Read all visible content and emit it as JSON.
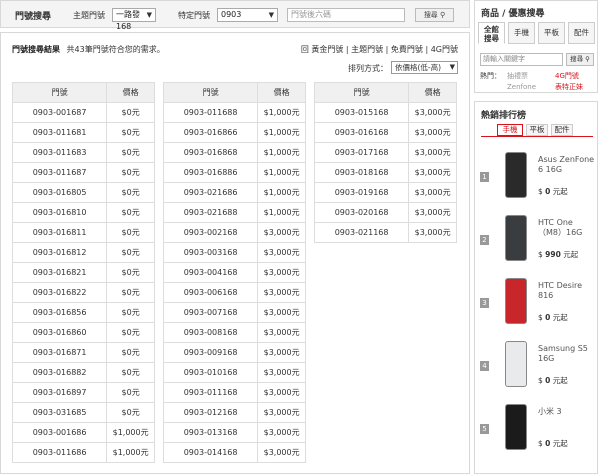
{
  "search": {
    "title": "門號搜尋",
    "theme_label": "主題門號",
    "theme_value": "一路發168",
    "prefix_label": "特定門號",
    "prefix_value": "0903",
    "suffix_placeholder": "門號後六碼",
    "button_label": "搜尋"
  },
  "results": {
    "title": "門號搜尋結果",
    "summary": "共43筆門號符合您的需求。",
    "filter_mark": "回",
    "filters": [
      "黃金門號",
      "主題門號",
      "免費門號",
      "4G門號"
    ],
    "sort_label": "排列方式：",
    "sort_value": "依價格(低-高)",
    "headers": {
      "number": "門號",
      "price": "價格"
    },
    "col1": [
      [
        "0903-001687",
        "$0元"
      ],
      [
        "0903-011681",
        "$0元"
      ],
      [
        "0903-011683",
        "$0元"
      ],
      [
        "0903-011687",
        "$0元"
      ],
      [
        "0903-016805",
        "$0元"
      ],
      [
        "0903-016810",
        "$0元"
      ],
      [
        "0903-016811",
        "$0元"
      ],
      [
        "0903-016812",
        "$0元"
      ],
      [
        "0903-016821",
        "$0元"
      ],
      [
        "0903-016822",
        "$0元"
      ],
      [
        "0903-016856",
        "$0元"
      ],
      [
        "0903-016860",
        "$0元"
      ],
      [
        "0903-016871",
        "$0元"
      ],
      [
        "0903-016882",
        "$0元"
      ],
      [
        "0903-016897",
        "$0元"
      ],
      [
        "0903-031685",
        "$0元"
      ],
      [
        "0903-001686",
        "$1,000元"
      ],
      [
        "0903-011686",
        "$1,000元"
      ]
    ],
    "col2": [
      [
        "0903-011688",
        "$1,000元"
      ],
      [
        "0903-016866",
        "$1,000元"
      ],
      [
        "0903-016868",
        "$1,000元"
      ],
      [
        "0903-016886",
        "$1,000元"
      ],
      [
        "0903-021686",
        "$1,000元"
      ],
      [
        "0903-021688",
        "$1,000元"
      ],
      [
        "0903-002168",
        "$3,000元"
      ],
      [
        "0903-003168",
        "$3,000元"
      ],
      [
        "0903-004168",
        "$3,000元"
      ],
      [
        "0903-006168",
        "$3,000元"
      ],
      [
        "0903-007168",
        "$3,000元"
      ],
      [
        "0903-008168",
        "$3,000元"
      ],
      [
        "0903-009168",
        "$3,000元"
      ],
      [
        "0903-010168",
        "$3,000元"
      ],
      [
        "0903-011168",
        "$3,000元"
      ],
      [
        "0903-012168",
        "$3,000元"
      ],
      [
        "0903-013168",
        "$3,000元"
      ],
      [
        "0903-014168",
        "$3,000元"
      ]
    ],
    "col3": [
      [
        "0903-015168",
        "$3,000元"
      ],
      [
        "0903-016168",
        "$3,000元"
      ],
      [
        "0903-017168",
        "$3,000元"
      ],
      [
        "0903-018168",
        "$3,000元"
      ],
      [
        "0903-019168",
        "$3,000元"
      ],
      [
        "0903-020168",
        "$3,000元"
      ],
      [
        "0903-021168",
        "$3,000元"
      ]
    ]
  },
  "product_search": {
    "title": "商品 / 優惠搜尋",
    "tabs": [
      "全館",
      "搜尋",
      "手機",
      "平板",
      "配件"
    ],
    "input_placeholder": "請輸入關鍵字",
    "button_label": "搜尋",
    "hot_label": "熱門：",
    "hot_keywords": [
      "抽禮票",
      "4G門號",
      "Zenfone",
      "表特正妹"
    ],
    "colors": {
      "red": "#d8131b",
      "gray": "#999999"
    }
  },
  "ranking": {
    "title": "熱銷排行榜",
    "tabs": [
      "手機",
      "平板",
      "配件"
    ],
    "price_prefix": "$",
    "price_suffix": "元起",
    "items": [
      {
        "rank": "1",
        "name": "Asus ZenFone 6 16G",
        "price": "0",
        "color": "#2a2a2a"
      },
      {
        "rank": "2",
        "name": "HTC One（M8）16G",
        "price": "990",
        "color": "#3a3d40"
      },
      {
        "rank": "3",
        "name": "HTC Desire 816",
        "price": "0",
        "color": "#c8262a"
      },
      {
        "rank": "4",
        "name": "Samsung S5 16G",
        "price": "0",
        "color": "#e8eaec"
      },
      {
        "rank": "5",
        "name": "小米 3",
        "price": "0",
        "color": "#1b1b1b"
      }
    ]
  }
}
